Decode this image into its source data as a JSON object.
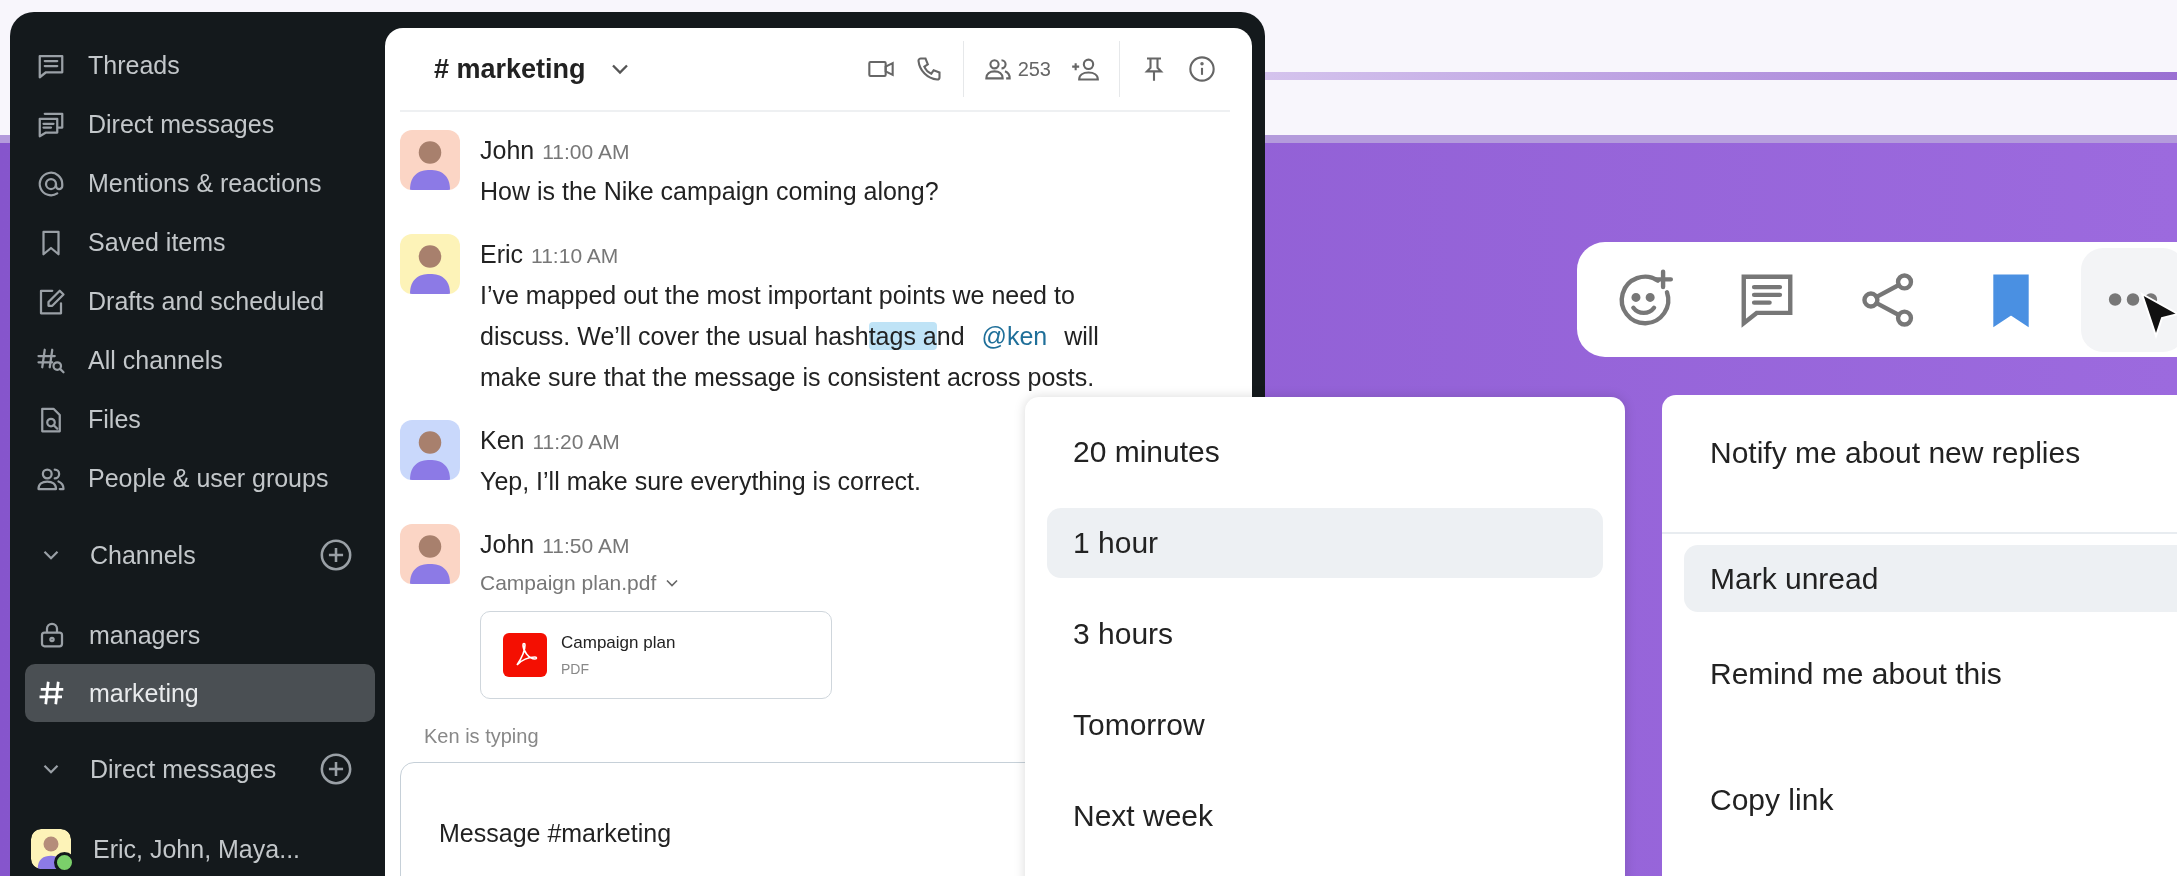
{
  "sidebar": {
    "nav_items": [
      {
        "label": "Threads",
        "kind": "threads"
      },
      {
        "label": "Direct messages",
        "kind": "dms"
      },
      {
        "label": "Mentions & reactions",
        "kind": "mentions"
      },
      {
        "label": "Saved items",
        "kind": "saved"
      },
      {
        "label": "Drafts and scheduled",
        "kind": "drafts"
      },
      {
        "label": "All channels",
        "kind": "channels"
      },
      {
        "label": "Files",
        "kind": "files"
      },
      {
        "label": "People & user groups",
        "kind": "people"
      }
    ],
    "sections": [
      {
        "title": "Channels",
        "expanded": true,
        "items": [
          {
            "label": "managers",
            "kind": "private",
            "selected": false
          },
          {
            "label": "marketing",
            "kind": "public",
            "selected": true
          }
        ]
      },
      {
        "title": "Direct messages",
        "expanded": true,
        "items": [
          {
            "label": "Eric, John, Maya...",
            "kind": "group",
            "selected": false,
            "online": true
          }
        ]
      }
    ]
  },
  "chat": {
    "title": "# marketing",
    "member_count": "253",
    "messages": [
      {
        "author": "John",
        "time": "11:00 AM",
        "color": "#fbd5c5",
        "parts": [
          {
            "kind": "plain",
            "text": "How is the Nike campaign coming along?"
          }
        ]
      },
      {
        "author": "Eric",
        "time": "11:10 AM",
        "color": "#fdf3b8",
        "parts": [
          {
            "kind": "plain",
            "text": "I’ve mapped out the most important points we need to discuss. We’ll cover the usual hash"
          },
          {
            "kind": "highlight",
            "text": "tags a"
          },
          {
            "kind": "plain",
            "text": "nd "
          },
          {
            "kind": "mention",
            "text": "@ken"
          },
          {
            "kind": "plain",
            "text": " will make sure that the message is consistent across posts."
          }
        ]
      },
      {
        "author": "Ken",
        "time": "11:20 AM",
        "color": "#c9d8fb",
        "parts": [
          {
            "kind": "plain",
            "text": "Yep, I’ll make sure everything is correct."
          }
        ]
      },
      {
        "author": "John",
        "time": "11:50 AM",
        "color": "#fbd5c5",
        "attachment": {
          "label": "Campaign plan.pdf",
          "file_name": "Campaign plan",
          "file_type": "PDF"
        }
      }
    ],
    "typing": "Ken is typing",
    "composer": {
      "placeholder": "Message #marketing"
    }
  },
  "snooze_menu": {
    "items": [
      {
        "label": "20 minutes",
        "selected": false
      },
      {
        "label": "1 hour",
        "selected": true
      },
      {
        "label": "3 hours",
        "selected": false
      },
      {
        "label": "Tomorrow",
        "selected": false
      },
      {
        "label": "Next week",
        "selected": false
      }
    ]
  },
  "message_actions": [
    {
      "kind": "reaction",
      "active": false,
      "selected": false
    },
    {
      "kind": "reply",
      "active": false,
      "selected": false
    },
    {
      "kind": "share",
      "active": false,
      "selected": false
    },
    {
      "kind": "save",
      "active": true,
      "selected": false
    },
    {
      "kind": "more",
      "active": false,
      "selected": true
    }
  ],
  "context_menu": {
    "items": [
      {
        "label": "Notify me about new replies",
        "selected": false,
        "separator_after": true
      },
      {
        "label": "Mark unread",
        "selected": true,
        "separator_after": false
      },
      {
        "label": "Remind me about this",
        "selected": false,
        "separator_after": false
      },
      {
        "label": "Copy link",
        "selected": false,
        "separator_after": false
      }
    ]
  }
}
